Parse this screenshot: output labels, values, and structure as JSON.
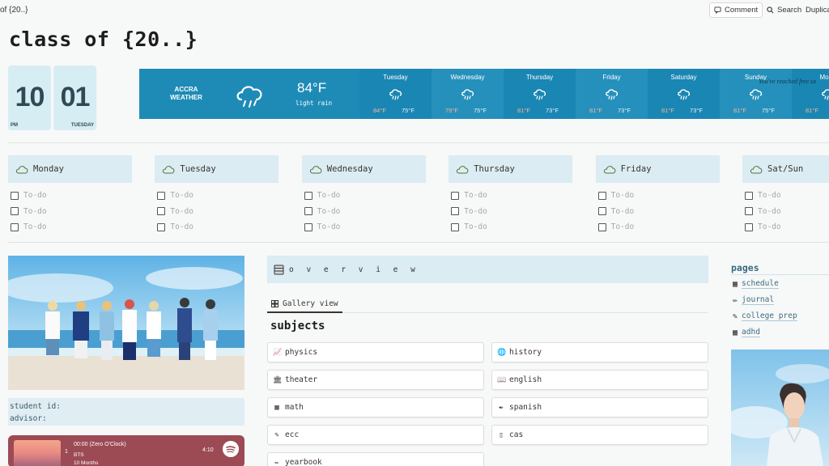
{
  "topbar": {
    "breadcrumb": "of {20..}",
    "comment": "Comment",
    "search": "Search",
    "duplicate": "Duplicat"
  },
  "page": {
    "title": "class of {20..}"
  },
  "clock": {
    "hour": "10",
    "hour_label": "PM",
    "minute": "01",
    "minute_label": "TUESDAY"
  },
  "weather": {
    "city_line1": "ACCRA",
    "city_line2": "WEATHER",
    "current_temp": "84°F",
    "condition": "light rain",
    "note": "You've reached free us",
    "days": [
      {
        "name": "Tuesday",
        "hi": "84°F",
        "lo": "75°F"
      },
      {
        "name": "Wednesday",
        "hi": "79°F",
        "lo": "75°F"
      },
      {
        "name": "Thursday",
        "hi": "81°F",
        "lo": "73°F"
      },
      {
        "name": "Friday",
        "hi": "81°F",
        "lo": "73°F"
      },
      {
        "name": "Saturday",
        "hi": "81°F",
        "lo": "73°F"
      },
      {
        "name": "Sunday",
        "hi": "81°F",
        "lo": "75°F"
      },
      {
        "name": "Mond",
        "hi": "81°F",
        "lo": ""
      }
    ],
    "colors": {
      "background": "#1e8bb7",
      "high": "#f6b4a2"
    }
  },
  "week": {
    "todo_placeholder": "To-do",
    "days": [
      "Monday",
      "Tuesday",
      "Wednesday",
      "Thursday",
      "Friday",
      "Sat/Sun"
    ]
  },
  "student": {
    "id_label": "student id:",
    "advisor_label": "advisor:"
  },
  "player": {
    "index": "1",
    "title": "00:00 (Zero O'Clock)",
    "artist": "BTS",
    "album": "10 Months",
    "duration": "4:10"
  },
  "overview": {
    "title": "o v e r v i e w"
  },
  "gallery": {
    "tab": "Gallery view",
    "section_title": "subjects",
    "cards": [
      {
        "label": "physics",
        "icon": "chart-icon"
      },
      {
        "label": "history",
        "icon": "globe-icon"
      },
      {
        "label": "theater",
        "icon": "building-icon"
      },
      {
        "label": "english",
        "icon": "book-icon"
      },
      {
        "label": "math",
        "icon": "calculator-icon"
      },
      {
        "label": "spanish",
        "icon": "pen-icon"
      },
      {
        "label": "ecc",
        "icon": "syringe-icon"
      },
      {
        "label": "cas",
        "icon": "document-icon"
      },
      {
        "label": "yearbook",
        "icon": "pencil-icon"
      }
    ]
  },
  "pages": {
    "title": "pages",
    "links": [
      {
        "label": "schedule",
        "icon": "calendar-icon"
      },
      {
        "label": "journal",
        "icon": "pencil-icon"
      },
      {
        "label": "college prep",
        "icon": "backpack-icon"
      },
      {
        "label": "adhd",
        "icon": "abacus-icon"
      }
    ]
  }
}
